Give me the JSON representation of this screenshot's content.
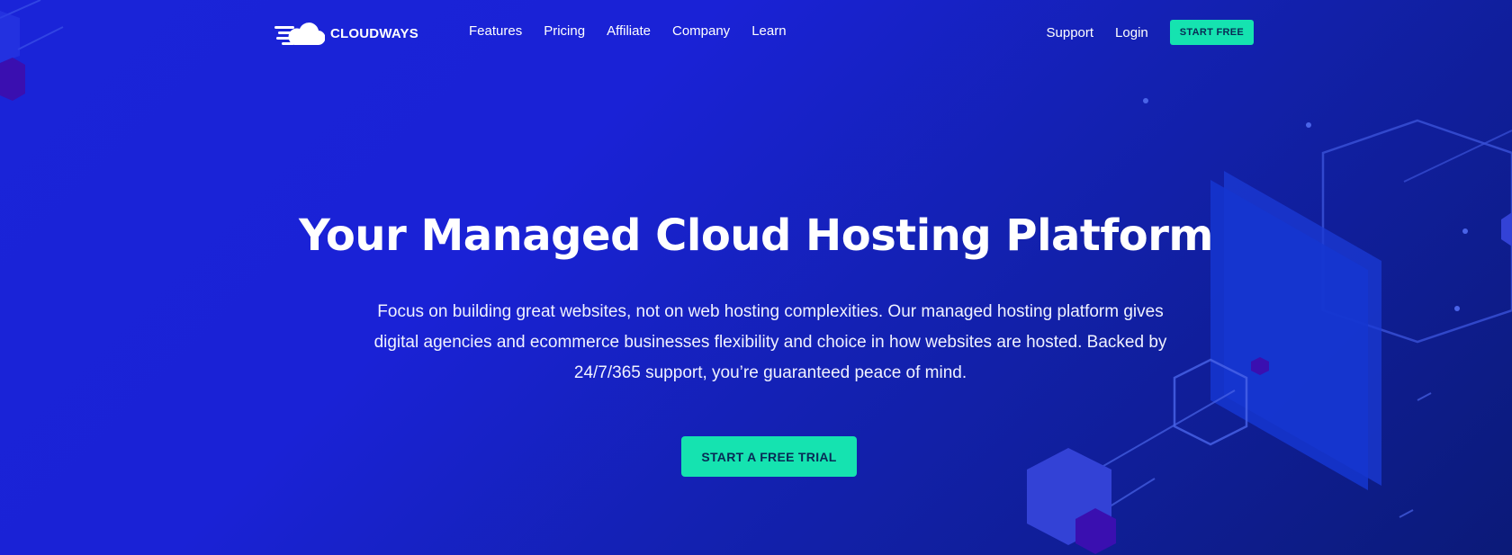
{
  "brand": {
    "name": "CLOUDWAYS",
    "logo_icon": "cloud-speed-icon"
  },
  "nav": {
    "links": [
      "Features",
      "Pricing",
      "Affiliate",
      "Company",
      "Learn"
    ],
    "support": "Support",
    "login": "Login",
    "start_free": "START FREE"
  },
  "hero": {
    "title": "Your Managed Cloud Hosting Platform",
    "description": "Focus on building great websites, not on web hosting complexities. Our managed hosting platform gives digital agencies and ecommerce businesses flexibility and choice in how websites are hosted. Backed by 24/7/365 support, you’re guaranteed peace of mind.",
    "cta": "START A FREE TRIAL"
  },
  "colors": {
    "background_start": "#1a24d8",
    "background_end": "#0b1a78",
    "accent": "#15e3b0",
    "button_text": "#082a55"
  }
}
